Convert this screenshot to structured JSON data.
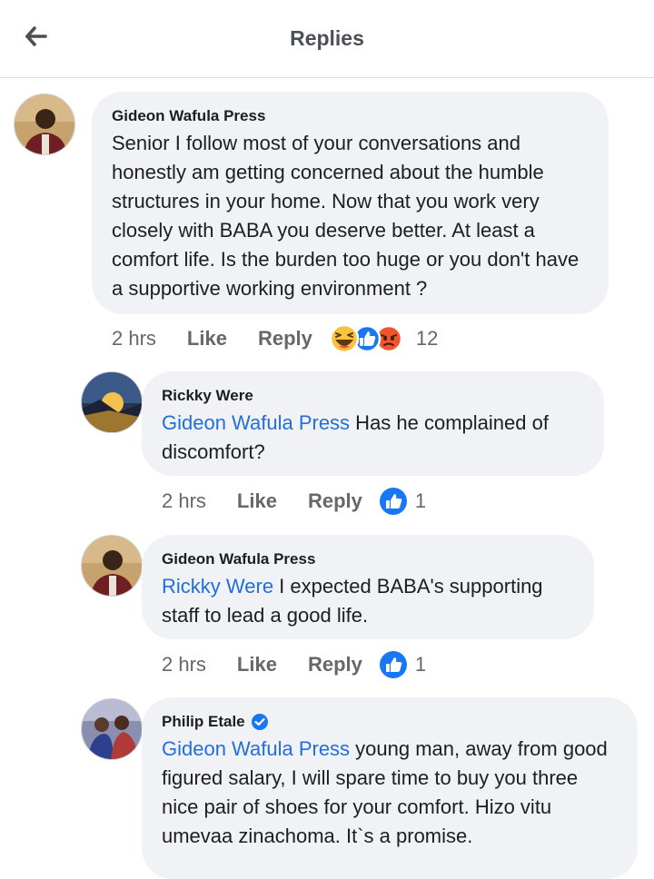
{
  "header": {
    "title": "Replies",
    "back_icon": "arrow-left-icon"
  },
  "colors": {
    "mention": "#216fdb",
    "bubble": "#f0f2f5",
    "like_blue": "#1877f2",
    "angry": "#f0552e",
    "haha": "#f7c43b"
  },
  "comments": [
    {
      "author": "Gideon Wafula Press",
      "mention": "",
      "text": "Senior I follow most of your conversations and honestly am getting concerned about the humble structures in your home. Now that you work very closely with BABA you deserve better. At least a comfort life. Is the burden too huge or you don't have a supportive working environment ?",
      "time": "2 hrs",
      "like": "Like",
      "reply": "Reply",
      "reactions": [
        "haha-icon",
        "like-icon",
        "angry-icon"
      ],
      "reaction_count": "12"
    },
    {
      "author": "Rickky Were",
      "mention": "Gideon Wafula Press",
      "text": " Has he complained of discomfort?",
      "time": "2 hrs",
      "like": "Like",
      "reply": "Reply",
      "reactions": [
        "like-icon"
      ],
      "reaction_count": "1"
    },
    {
      "author": "Gideon Wafula Press",
      "mention": "Rickky Were",
      "text": " I expected BABA's supporting staff to lead a good life.",
      "time": "2 hrs",
      "like": "Like",
      "reply": "Reply",
      "reactions": [
        "like-icon"
      ],
      "reaction_count": "1"
    },
    {
      "author": "Philip Etale",
      "verified": true,
      "mention": "Gideon Wafula Press",
      "text": " young man, away from good figured salary, I will spare time to buy you three nice pair of shoes for your comfort. Hizo vitu umevaa zinachoma. It`s a promise."
    }
  ]
}
